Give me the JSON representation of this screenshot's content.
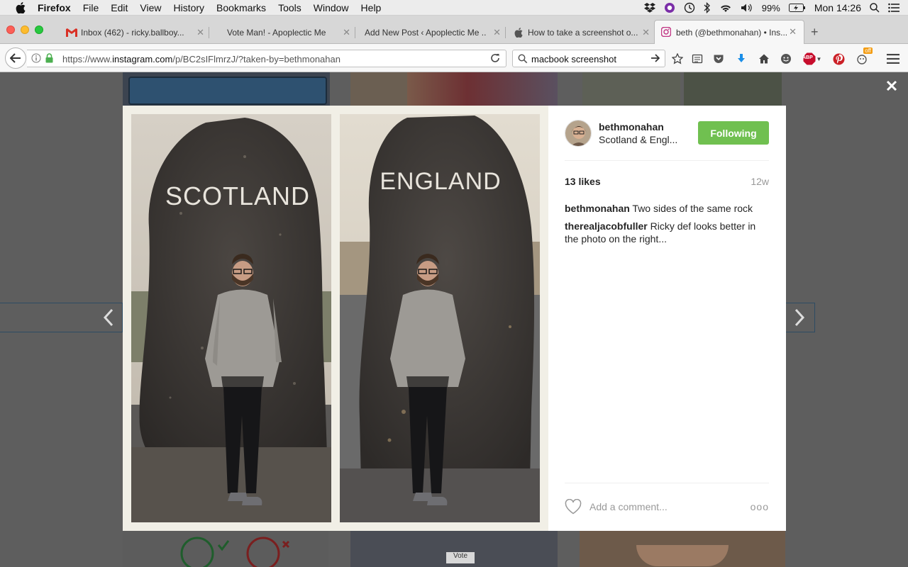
{
  "menubar": {
    "app": "Firefox",
    "items": [
      "File",
      "Edit",
      "View",
      "History",
      "Bookmarks",
      "Tools",
      "Window",
      "Help"
    ],
    "battery": "99%",
    "clock": "Mon 14:26"
  },
  "tabs": [
    {
      "title": "Inbox (462) - ricky.ballboy...",
      "icon": "gmail-icon"
    },
    {
      "title": "Vote Man! - Apoplectic Me",
      "icon": "blank-page-icon"
    },
    {
      "title": "Add New Post ‹ Apoplectic Me ...",
      "icon": "blank-page-icon"
    },
    {
      "title": "How to take a screenshot o...",
      "icon": "apple-icon"
    },
    {
      "title": "beth (@bethmonahan) • Ins...",
      "icon": "instagram-icon",
      "active": true
    }
  ],
  "navbar": {
    "url_prefix": "https://www.",
    "url_domain": "instagram.com",
    "url_rest": "/p/BC2sIFlmrzJ/?taken-by=bethmonahan",
    "search_value": "macbook screenshot",
    "adblock_badge": "ABP",
    "extension_badge": "off"
  },
  "photo": {
    "left_sign": "SCOTLAND",
    "right_sign": "ENGLAND"
  },
  "post": {
    "username": "bethmonahan",
    "location": "Scotland & Engl...",
    "follow_label": "Following",
    "likes": "13 likes",
    "age": "12w",
    "comments": [
      {
        "user": "bethmonahan",
        "text": "Two sides of the same rock"
      },
      {
        "user": "therealjacobfuller",
        "text": "Ricky def looks better in the photo on the right..."
      }
    ],
    "add_comment_placeholder": "Add a comment...",
    "more_label": "ooo"
  },
  "colors": {
    "follow_green": "#70c050",
    "backdrop": "#5e5e5e"
  }
}
